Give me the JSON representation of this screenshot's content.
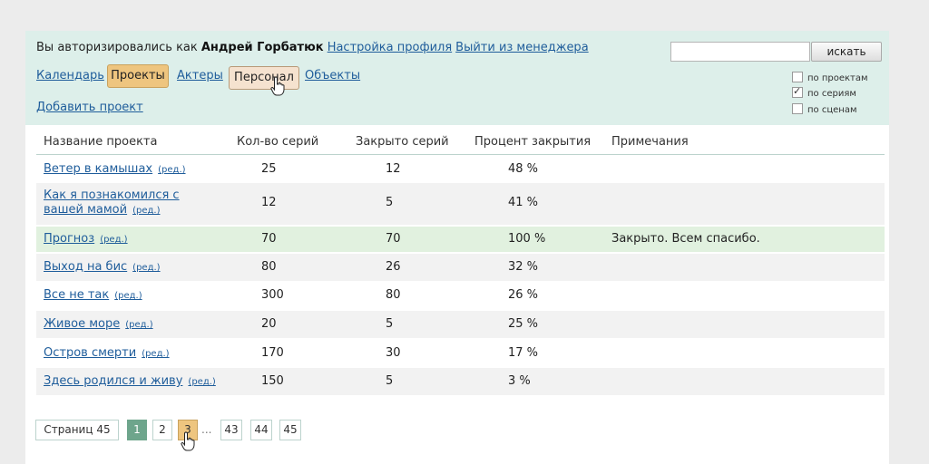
{
  "header": {
    "login_prefix": "Вы авторизировались как",
    "user_name": "Андрей Горбатюк",
    "profile_link": "Настройка профиля",
    "logout_link": "Выйти из менеджера",
    "nav": {
      "calendar": "Календарь",
      "projects": "Проекты",
      "actors": "Актеры",
      "personnel": "Персонал",
      "objects": "Объекты"
    },
    "add_project": "Добавить проект"
  },
  "search": {
    "input_value": "",
    "button_label": "искать",
    "options": [
      {
        "label": "по проектам",
        "checked": false
      },
      {
        "label": "по сериям",
        "checked": true
      },
      {
        "label": "по сценам",
        "checked": false
      }
    ]
  },
  "table": {
    "columns": [
      "Название проекта",
      "Кол-во серий",
      "Закрыто серий",
      "Процент закрытия",
      "Примечания"
    ],
    "edit_label": "(ред.)",
    "rows": [
      {
        "name_1": "Ветер в камышах",
        "name_2": "",
        "episodes": "25",
        "closed": "12",
        "percent": "48 %",
        "note": ""
      },
      {
        "name_1": "Как я познакомился с",
        "name_2": "вашей мамой",
        "episodes": "12",
        "closed": "5",
        "percent": "41 %",
        "note": ""
      },
      {
        "name_1": "Прогноз",
        "name_2": "",
        "episodes": "70",
        "closed": "70",
        "percent": "100 %",
        "note": "Закрыто. Всем спасибо."
      },
      {
        "name_1": "Выход на бис",
        "name_2": "",
        "episodes": "80",
        "closed": "26",
        "percent": "32 %",
        "note": ""
      },
      {
        "name_1": "Все не так",
        "name_2": "",
        "episodes": "300",
        "closed": "80",
        "percent": "26 %",
        "note": ""
      },
      {
        "name_1": "Живое море",
        "name_2": "",
        "episodes": "20",
        "closed": "5",
        "percent": "25 %",
        "note": ""
      },
      {
        "name_1": "Остров смерти",
        "name_2": "",
        "episodes": "170",
        "closed": "30",
        "percent": "17 %",
        "note": ""
      },
      {
        "name_1": "Здесь родился и живу",
        "name_2": "",
        "episodes": "150",
        "closed": "5",
        "percent": "3 %",
        "note": ""
      }
    ]
  },
  "pager": {
    "pages_label": "Страниц 45",
    "pages": [
      "1",
      "2",
      "3",
      "43",
      "44",
      "45"
    ],
    "ellipsis": "..."
  },
  "colors": {
    "header_bg": "#ddefea",
    "link": "#1f5d9b",
    "active_tab": "#eec57f",
    "closed_row": "#e1f1df",
    "current_page": "#6ea58c"
  }
}
